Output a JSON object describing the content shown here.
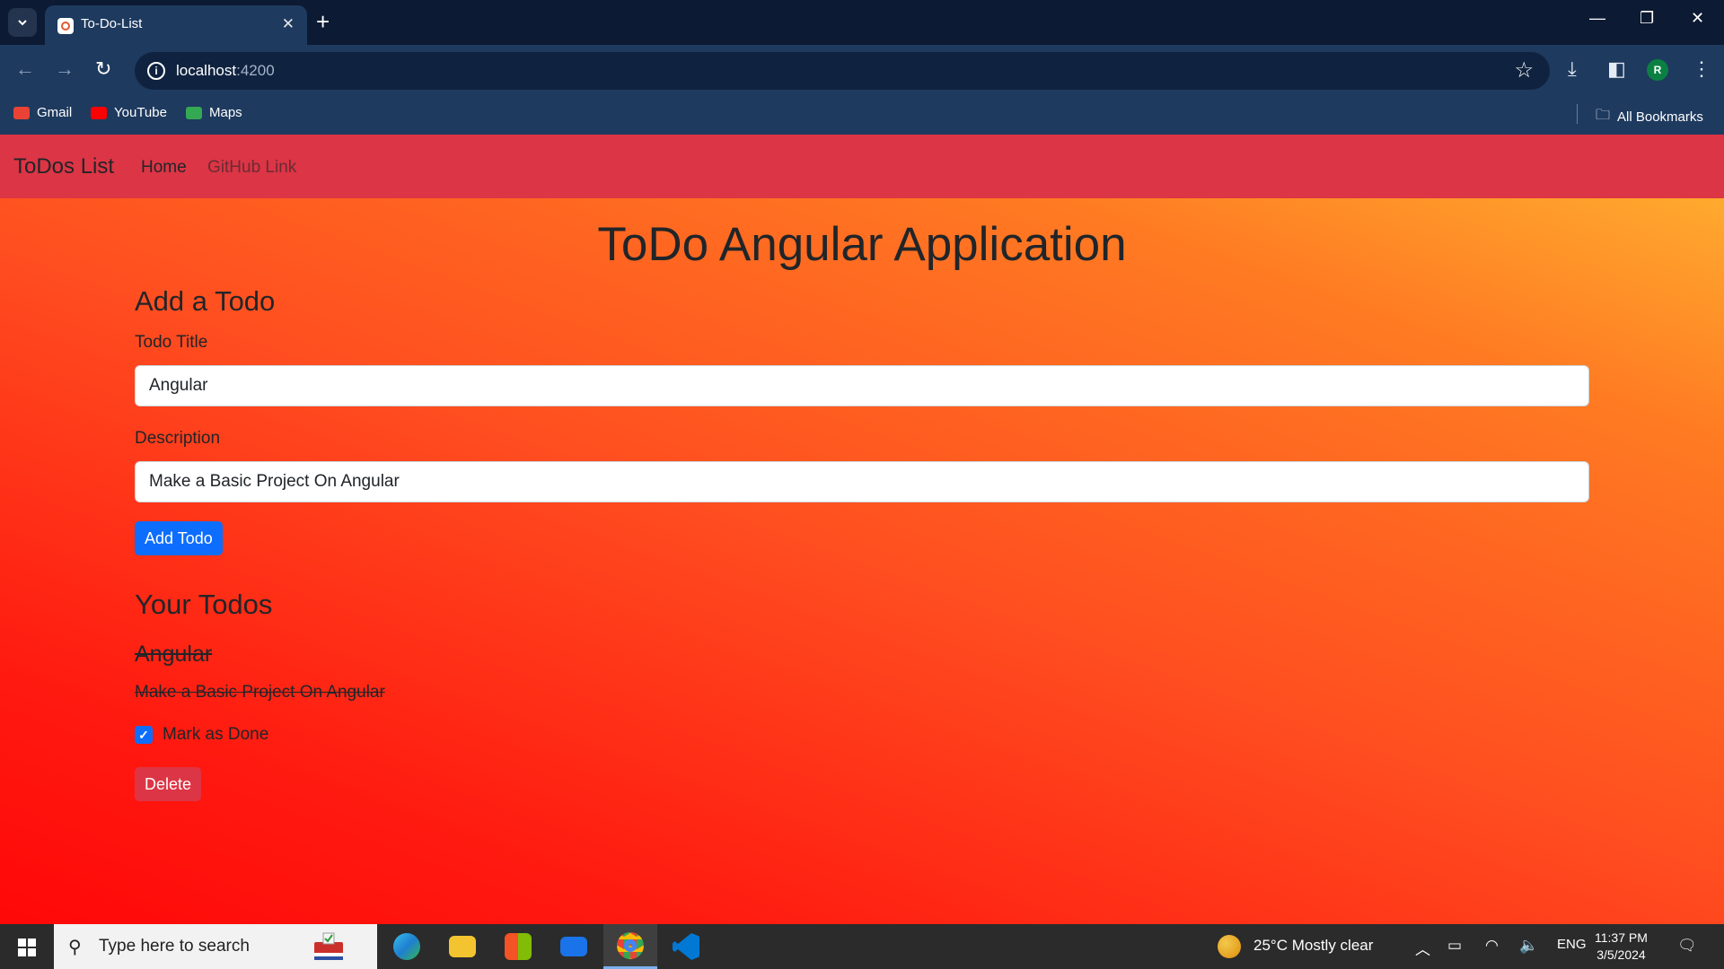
{
  "browser": {
    "tab_title": "To-Do-List",
    "url_host": "localhost",
    "url_port": ":4200",
    "bookmarks": [
      {
        "label": "Gmail",
        "icon": "gmail-icon",
        "color": "#ea4335"
      },
      {
        "label": "YouTube",
        "icon": "youtube-icon",
        "color": "#ff0000"
      },
      {
        "label": "Maps",
        "icon": "maps-icon",
        "color": "#34a853"
      }
    ],
    "all_bookmarks_label": "All Bookmarks",
    "profile_initial": "R"
  },
  "page": {
    "brand": "ToDos List",
    "nav": {
      "home": "Home",
      "github": "GitHub Link"
    },
    "heading": "ToDo Angular Application",
    "add_section": {
      "title": "Add a Todo",
      "title_label": "Todo Title",
      "title_value": "Angular",
      "desc_label": "Description",
      "desc_value": "Make a Basic Project On Angular",
      "add_button": "Add Todo"
    },
    "todos_section": {
      "title": "Your Todos",
      "items": [
        {
          "title": "Angular",
          "description": "Make a Basic Project On Angular",
          "done": true,
          "check_label": "Mark as Done",
          "delete_label": "Delete"
        }
      ]
    },
    "colors": {
      "navbar": "#dc3545",
      "primary": "#0d6efd",
      "danger": "#dc3545"
    }
  },
  "taskbar": {
    "search_placeholder": "Type here to search",
    "weather": "25°C  Mostly clear",
    "language": "ENG",
    "time": "11:37 PM",
    "date": "3/5/2024"
  }
}
